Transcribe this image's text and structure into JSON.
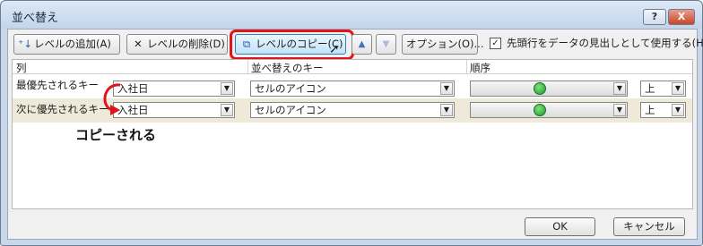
{
  "window": {
    "title": "並べ替え",
    "help_label": "?",
    "close_label": "X"
  },
  "toolbar": {
    "add_level": "レベルの追加(A)",
    "delete_level": "レベルの削除(D)",
    "copy_level": "レベルのコピー(C)",
    "move_up": "▲",
    "move_down": "▼",
    "options": "オプション(O)...",
    "header_checkbox_label": "先頭行をデータの見出しとして使用する(H)",
    "header_checkbox_checked": true
  },
  "grid": {
    "headers": {
      "column": "列",
      "sort_on": "並べ替えのキー",
      "order": "順序"
    },
    "rows": [
      {
        "label": "最優先されるキー",
        "column": "入社日",
        "sort_on": "セルのアイコン",
        "icon_name": "green-circle-icon",
        "position": "上"
      },
      {
        "label": "次に優先されるキー",
        "column": "入社日",
        "sort_on": "セルのアイコン",
        "icon_name": "green-circle-icon",
        "position": "上"
      }
    ]
  },
  "annotation": {
    "text": "コピーされる",
    "color": "#e0141b"
  },
  "footer": {
    "ok": "OK",
    "cancel": "キャンセル"
  }
}
